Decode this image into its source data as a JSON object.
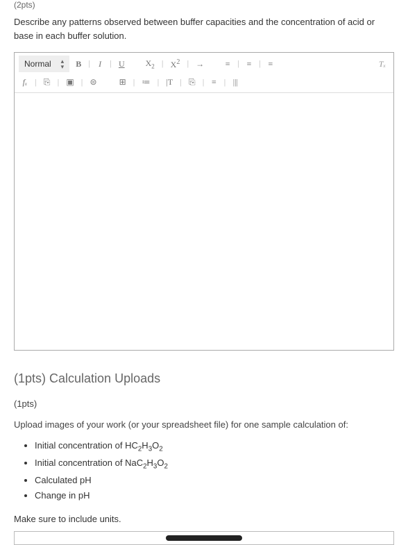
{
  "q1": {
    "points": "(2pts)",
    "prompt": "Describe any patterns observed between buffer capacities and the concentration of acid or base in each buffer solution."
  },
  "toolbar": {
    "style": "Normal",
    "bold": "B",
    "italic": "I",
    "underline": "U",
    "sub": "X",
    "sup": "X",
    "arrow": "→",
    "list1": "≡",
    "list2": "≡",
    "indent": "≡",
    "clear": "Tₓ",
    "fx": "fₓ",
    "link": "⎘",
    "image": "▣",
    "attach": "⊜",
    "table": "⊞",
    "align": "≔",
    "tex": "|T",
    "paste": "⎘",
    "hr": "≡",
    "code": "|||"
  },
  "section": {
    "header": "(1pts) Calculation Uploads",
    "points": "(1pts)",
    "intro": "Upload images of your work (or your spreadsheet file) for one sample calculation of:",
    "items_html": {
      "i0_pre": "Initial concentration of HC",
      "i0_sub1": "2",
      "i0_mid": "H",
      "i0_sub2": "3",
      "i0_mid2": "O",
      "i0_sub3": "2",
      "i1_pre": "Initial concentration of NaC",
      "i1_sub1": "2",
      "i1_mid": "H",
      "i1_sub2": "3",
      "i1_mid2": "O",
      "i1_sub3": "2",
      "i2": "Calculated pH",
      "i3": "Change in pH"
    },
    "units_note": "Make sure to include units."
  }
}
